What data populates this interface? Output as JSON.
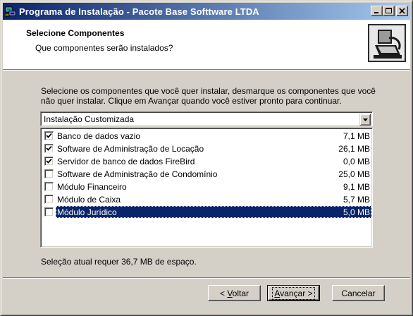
{
  "window": {
    "title": "Programa de Instalação - Pacote Base Softtware LTDA"
  },
  "header": {
    "title": "Selecione Componentes",
    "subtitle": "Que componentes serão instalados?"
  },
  "description": "Selecione os componentes que você quer instalar, desmarque os componentes que você não quer instalar. Clique em Avançar quando você estiver pronto para continuar.",
  "setup_type": {
    "selected": "Instalação Customizada"
  },
  "components": [
    {
      "label": "Banco de dados vazio",
      "size": "7,1 MB",
      "checked": true
    },
    {
      "label": "Software de Administração de Locação",
      "size": "26,1 MB",
      "checked": true
    },
    {
      "label": "Servidor de banco de dados FireBird",
      "size": "0,0 MB",
      "checked": true
    },
    {
      "label": "Software de Administração de Condomínio",
      "size": "25,0 MB",
      "checked": false
    },
    {
      "label": "Módulo Financeiro",
      "size": "9,1 MB",
      "checked": false
    },
    {
      "label": "Módulo de Caixa",
      "size": "5,7 MB",
      "checked": false
    },
    {
      "label": "Módulo Jurídico",
      "size": "5,0 MB",
      "checked": false,
      "selected": true
    }
  ],
  "status": "Seleção atual requer 36,7 MB de espaço.",
  "buttons": {
    "back": {
      "prefix": "< ",
      "accel": "V",
      "rest": "oltar"
    },
    "next": {
      "accel": "A",
      "rest": "vançar",
      "suffix": " >"
    },
    "cancel": "Cancelar"
  },
  "colors": {
    "face": "#d4d0c8",
    "titlebar_start": "#0a246a",
    "titlebar_end": "#a6caf0",
    "selection": "#0a246a"
  }
}
